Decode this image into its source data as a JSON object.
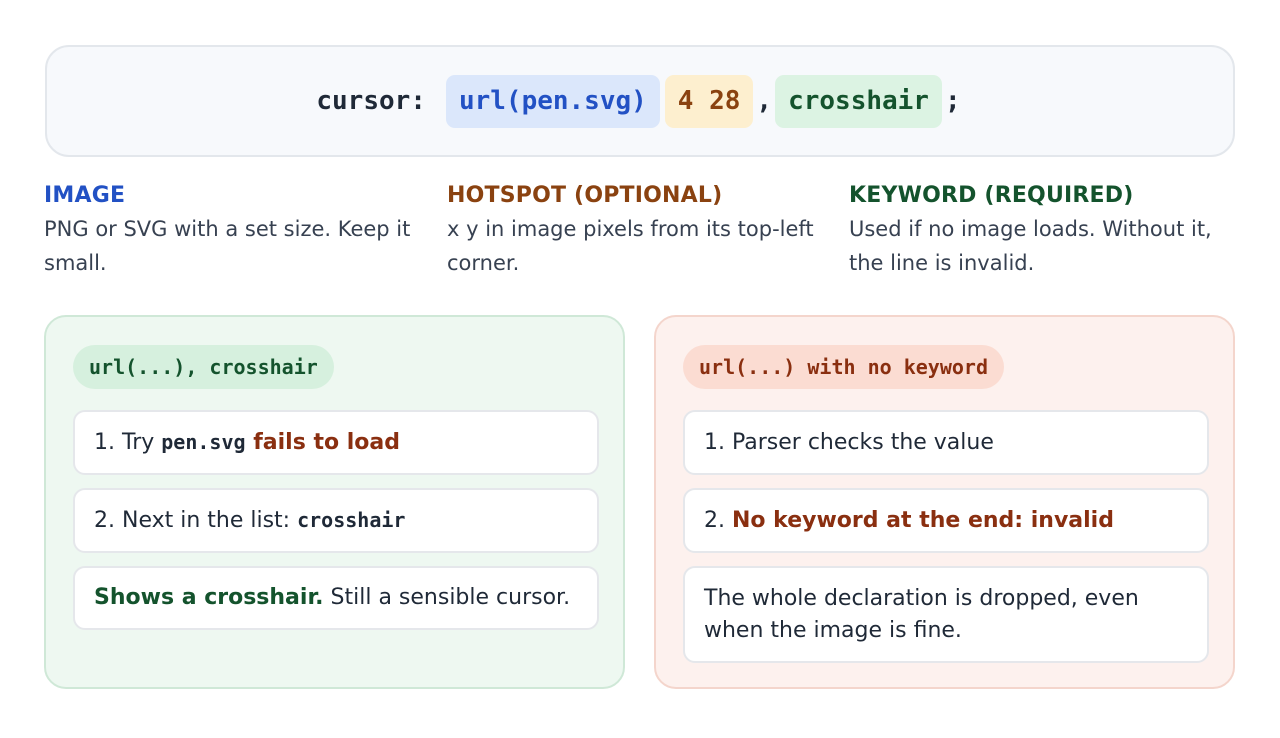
{
  "declaration": {
    "property": "cursor:",
    "url": "url(pen.svg)",
    "hotspot": "4 28",
    "comma": ",",
    "keyword": "crosshair",
    "semicolon": ";"
  },
  "columns": [
    {
      "title": "IMAGE",
      "desc": "PNG or SVG with a set size. Keep it small.",
      "color": "#2251c4"
    },
    {
      "title": "HOTSPOT (OPTIONAL)",
      "desc": "x y in image pixels from its top-left corner.",
      "color": "#8a4210"
    },
    {
      "title": "KEYWORD (REQUIRED)",
      "desc": "Used if no image loads. Without it, the line is invalid.",
      "color": "#14532d"
    }
  ],
  "panel_ok": {
    "tag": "url(...), crosshair",
    "step1": {
      "prefix": "1. Try ",
      "code": "pen.svg",
      "emph": " fails to load"
    },
    "step2": {
      "prefix": "2. Next in the list: ",
      "code": "crosshair"
    },
    "step3": {
      "emph": "Shows a crosshair.",
      "rest": " Still a sensible cursor."
    }
  },
  "panel_bad": {
    "tag": "url(...) with no keyword",
    "step1": {
      "text": "1. Parser checks the value"
    },
    "step2": {
      "prefix": "2. ",
      "emph": "No keyword at the end: invalid"
    },
    "step3": {
      "text": "The whole declaration is dropped, even when the image is fine."
    }
  },
  "colors": {
    "blue": "#2251c4",
    "orange": "#8a4210",
    "green": "#14532d",
    "red": "#8a2f10"
  }
}
